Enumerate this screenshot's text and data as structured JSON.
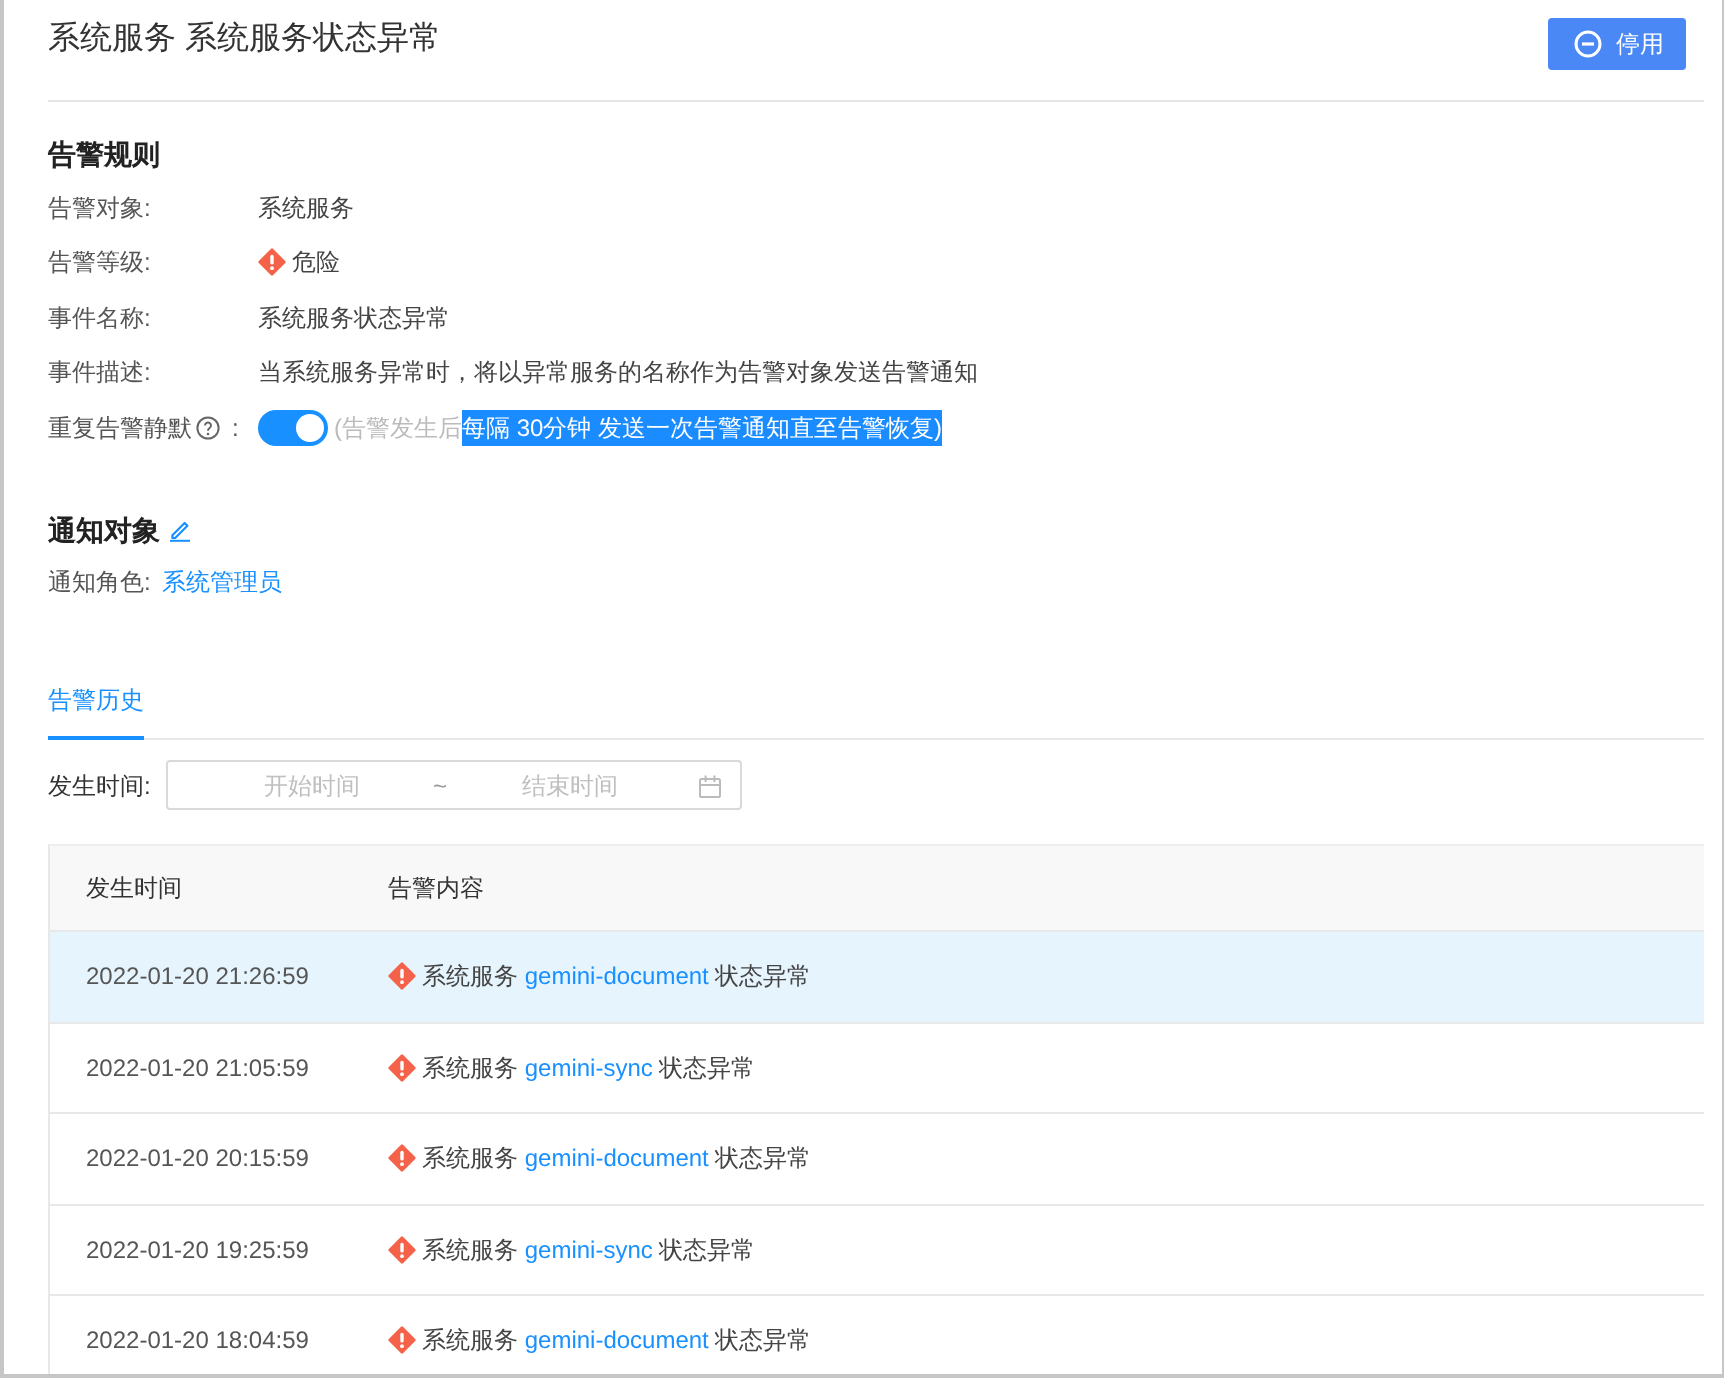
{
  "header": {
    "title": "系统服务 系统服务状态异常",
    "button": "停用"
  },
  "rules": {
    "heading": "告警规则",
    "fields": [
      {
        "kind": "text",
        "label": "告警对象:",
        "value": "系统服务"
      },
      {
        "kind": "level",
        "label": "告警等级:",
        "value": "危险"
      },
      {
        "kind": "text",
        "label": "事件名称:",
        "value": "系统服务状态异常"
      },
      {
        "kind": "text",
        "label": "事件描述:",
        "value": "当系统服务异常时，将以异常服务的名称作为告警对象发送告警通知"
      },
      {
        "kind": "switch",
        "label": "重复告警静默",
        "colon": ":",
        "on": true,
        "hint": [
          {
            "text": "(告警发生后",
            "selected": false
          },
          {
            "text": "每隔 30分钟 发送一次告警通知直至告警恢复)",
            "selected": true
          }
        ]
      }
    ]
  },
  "notify": {
    "heading": "通知对象",
    "label": "通知角色:",
    "role": "系统管理员"
  },
  "history": {
    "tabs": [
      {
        "label": "告警历史",
        "selected": true
      }
    ],
    "filter": {
      "label": "发生时间:",
      "start_placeholder": "开始时间",
      "separator": "~",
      "end_placeholder": "结束时间"
    },
    "table": {
      "columns": [
        "发生时间",
        "告警内容"
      ],
      "rows": [
        {
          "time": "2022-01-20 21:26:59",
          "prefix": "系统服务",
          "service": "gemini-document",
          "suffix": "状态异常",
          "selected": true
        },
        {
          "time": "2022-01-20 21:05:59",
          "prefix": "系统服务",
          "service": "gemini-sync",
          "suffix": "状态异常",
          "selected": false
        },
        {
          "time": "2022-01-20 20:15:59",
          "prefix": "系统服务",
          "service": "gemini-document",
          "suffix": "状态异常",
          "selected": false
        },
        {
          "time": "2022-01-20 19:25:59",
          "prefix": "系统服务",
          "service": "gemini-sync",
          "suffix": "状态异常",
          "selected": false
        },
        {
          "time": "2022-01-20 18:04:59",
          "prefix": "系统服务",
          "service": "gemini-document",
          "suffix": "状态异常",
          "selected": false
        }
      ]
    }
  }
}
